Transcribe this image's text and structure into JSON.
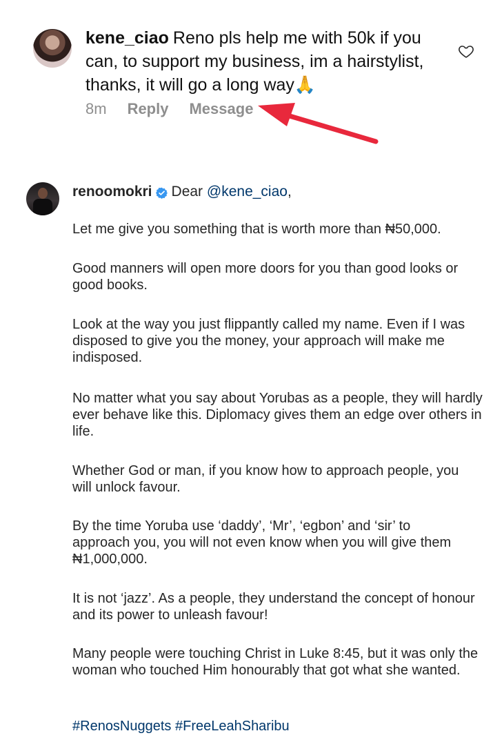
{
  "comment1": {
    "username": "kene_ciao",
    "text": "Reno pls help me with 50k if you can, to support my business, im a hairstylist, thanks, it will go a long way🙏",
    "time": "8m",
    "reply_label": "Reply",
    "message_label": "Message"
  },
  "comment2": {
    "username": "renoomokri",
    "greeting_prefix": "Dear ",
    "mention": "@kene_ciao",
    "greeting_suffix": ",",
    "paragraphs": [
      "Let me give you something that is worth more than ₦50,000.",
      "Good manners will open more doors for you than good looks or good books.",
      "Look at the way you just flippantly called my name. Even if I was disposed to give you the money, your approach will make me indisposed.",
      "No matter what you say about Yorubas as a people, they will hardly ever behave like this. Diplomacy gives them an edge over others in life.",
      "Whether God or man, if you know how to approach people, you will unlock favour.",
      "By the time Yoruba use ‘daddy’, ‘Mr’, ‘egbon’ and ‘sir’ to approach you, you will not even know when you will give them ₦1,000,000.",
      "It is not ‘jazz’. As a people, they understand the concept of honour and its power to unleash favour!",
      "Many people were touching Christ in Luke 8:45, but it was only the woman who touched Him honourably that got what she wanted."
    ],
    "hashtags": "#RenosNuggets #FreeLeahSharibu"
  },
  "icons": {
    "heart": "heart-outline-icon",
    "verified": "verified-badge-icon",
    "annotation": "red-arrow-annotation"
  },
  "colors": {
    "link": "#00376b",
    "verified": "#3897f0",
    "muted": "#8e8e8e",
    "arrow": "#e8283c"
  }
}
